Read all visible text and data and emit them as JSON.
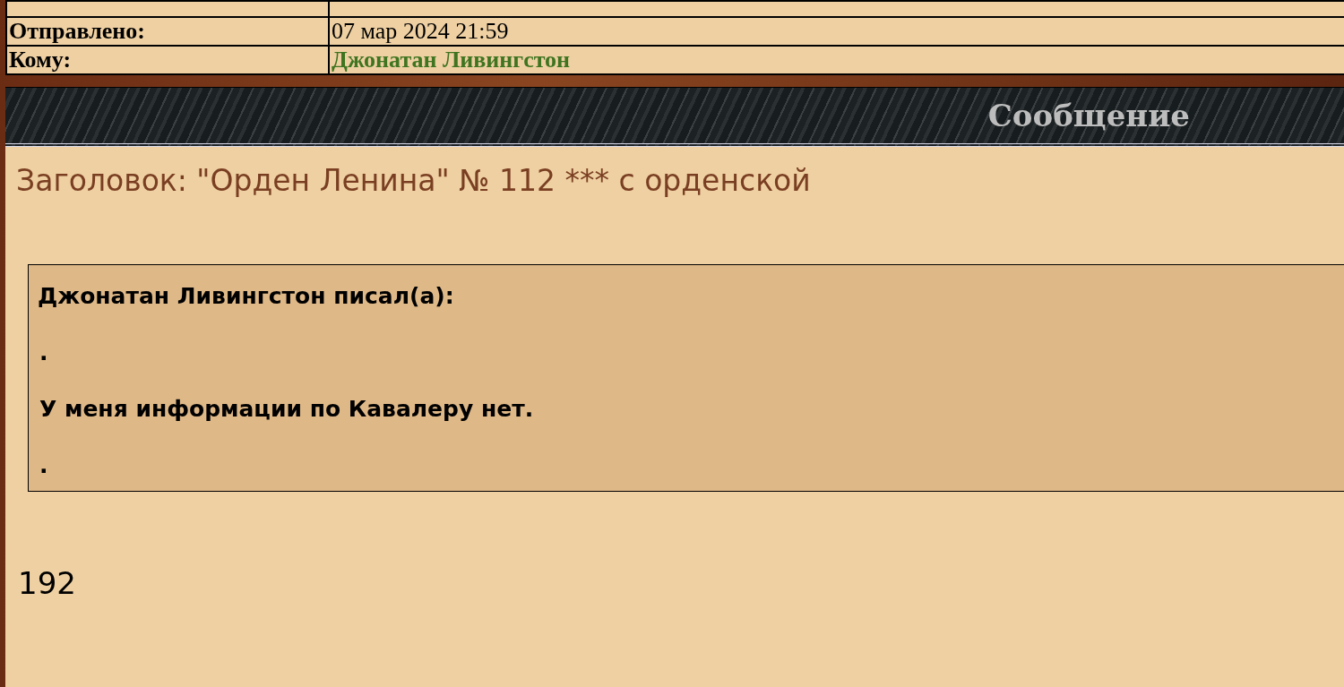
{
  "header_table": {
    "rows": [
      {
        "label": "Отправлено:",
        "value": "07 мар 2024 21:59",
        "kind": "plain"
      },
      {
        "label": "Кому:",
        "value": "Джонатан Ливингстон",
        "kind": "user"
      }
    ]
  },
  "section_title": "Сообщение",
  "message": {
    "subject": "Заголовок: \"Орден Ленина\" № 112 *** с орденской",
    "quote": {
      "author": "Джонатан Ливингстон писал(а):",
      "lines": [
        ".",
        "У меня информации по Кавалеру нет.",
        "."
      ]
    },
    "body": "192"
  }
}
